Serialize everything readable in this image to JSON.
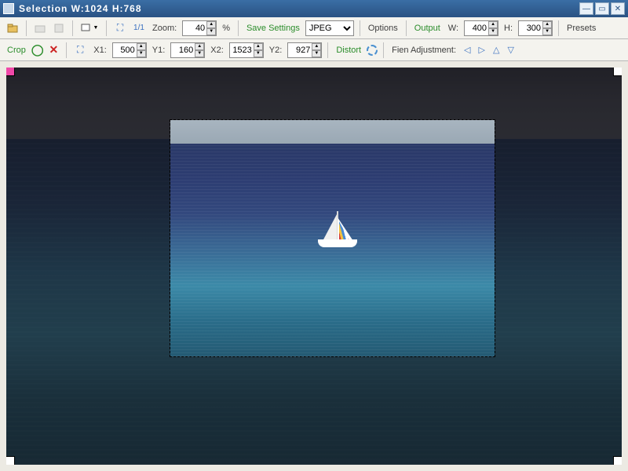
{
  "title": "Selection  W:1024 H:768",
  "toolbar1": {
    "zoom_label": "Zoom:",
    "zoom_value": "40",
    "percent": "%",
    "save_settings": "Save Settings",
    "format_options": [
      "JPEG"
    ],
    "format_selected": "JPEG",
    "options": "Options",
    "output": "Output",
    "w_label": "W:",
    "w_value": "400",
    "h_label": "H:",
    "h_value": "300",
    "presets": "Presets"
  },
  "toolbar2": {
    "crop_label": "Crop",
    "x1_label": "X1:",
    "x1_value": "500",
    "y1_label": "Y1:",
    "y1_value": "160",
    "x2_label": "X2:",
    "x2_value": "1523",
    "y2_label": "Y2:",
    "y2_value": "927",
    "distort": "Distort",
    "fine_adj": "Fien Adjustment:"
  },
  "icons": {
    "one_to_one": "1/1"
  },
  "selection": {
    "left_pct": 26.5,
    "top_pct": 13,
    "width_pct": 53,
    "height_pct": 60
  },
  "colors": {
    "title_bg": "#2a5283",
    "green": "#2a8c2a"
  }
}
